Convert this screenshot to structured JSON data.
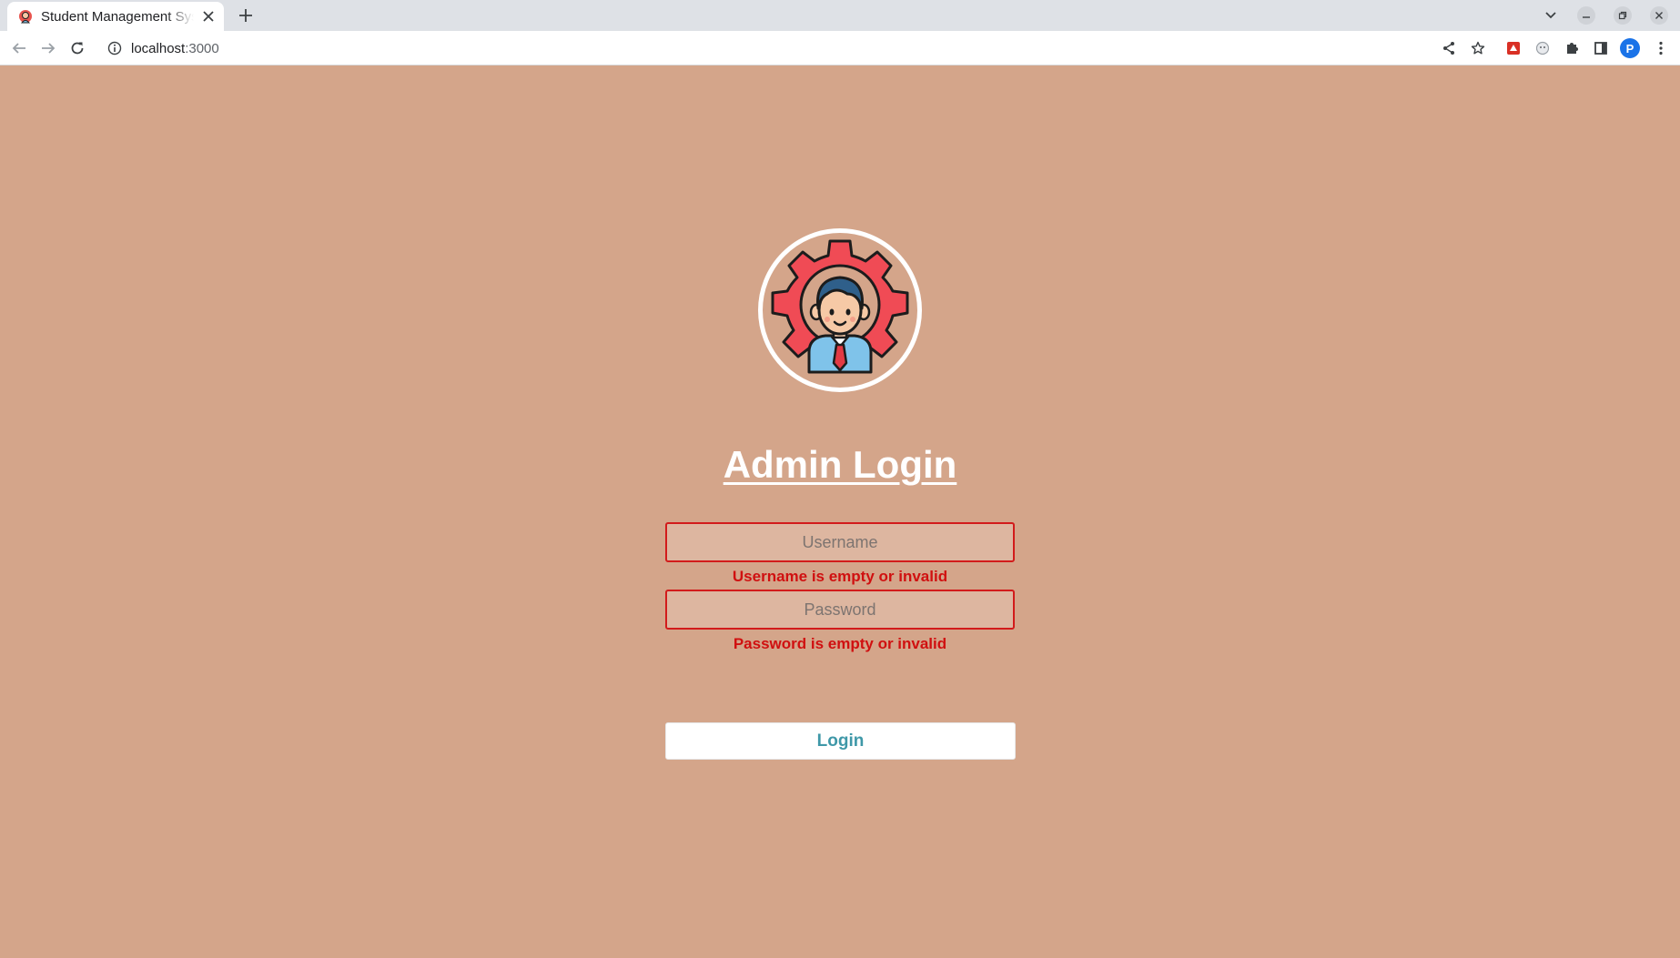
{
  "browser": {
    "tab_title": "Student Management System",
    "url_host": "localhost",
    "url_port": ":3000",
    "profile_initial": "P"
  },
  "icons": {
    "favicon": "admin-avatar-icon",
    "close": "close-icon",
    "new_tab": "plus-icon",
    "back": "arrow-left-icon",
    "forward": "arrow-right-icon",
    "reload": "reload-icon",
    "site_info": "info-icon",
    "share": "share-icon",
    "bookmark": "star-icon",
    "extensions": "puzzle-icon",
    "side_panel": "side-panel-icon",
    "menu": "kebab-menu-icon",
    "logo": "admin-gear-avatar-icon"
  },
  "login": {
    "heading": "Admin Login",
    "username_placeholder": "Username",
    "username_value": "",
    "username_error": "Username is empty or invalid",
    "password_placeholder": "Password",
    "password_value": "",
    "password_error": "Password is empty or invalid",
    "button_label": "Login"
  },
  "colors": {
    "page_background": "#d4a58a",
    "error": "#d01010",
    "button_text": "#3f98a8",
    "gear": "#f04b55",
    "shirt": "#7fc3ea",
    "hair": "#2f5f8a"
  }
}
